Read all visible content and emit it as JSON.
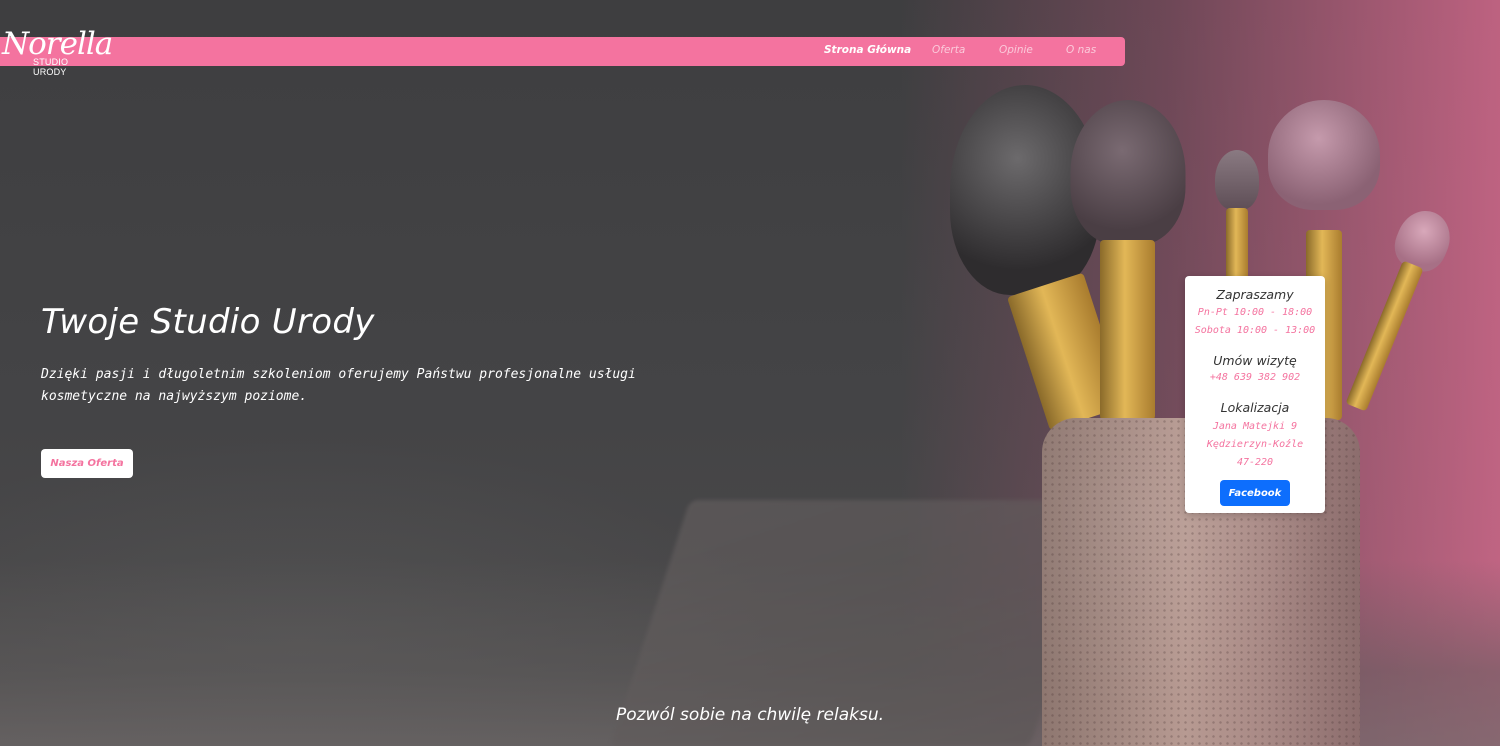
{
  "brand": {
    "logo_script": "Norella",
    "logo_subtitle": "STUDIO URODY"
  },
  "nav": {
    "items": [
      {
        "label": "Strona Główna",
        "active": true
      },
      {
        "label": "Oferta",
        "active": false
      },
      {
        "label": "Opinie",
        "active": false
      },
      {
        "label": "O nas",
        "active": false
      }
    ]
  },
  "hero": {
    "title": "Twoje Studio Urody",
    "description": "Dzięki pasji i długoletnim szkoleniom oferujemy Państwu profesjonalne usługi kosmetyczne na najwyższym poziome.",
    "button_label": "Nasza Oferta",
    "tagline": "Pozwól sobie na chwilę relaksu."
  },
  "info_card": {
    "hours_heading": "Zapraszamy",
    "hours_weekdays": "Pn-Pt 10:00 - 18:00",
    "hours_saturday": "Sobota 10:00 - 13:00",
    "contact_heading": "Umów wizytę",
    "phone": "+48 639 382 902",
    "location_heading": "Lokalizacja",
    "street": "Jana Matejki 9",
    "city": "Kędzierzyn-Koźle",
    "postal_code": "47-220",
    "facebook_label": "Facebook"
  },
  "colors": {
    "accent_pink": "#f4739f",
    "facebook_blue": "#0d6efd",
    "overlay_dark": "#3c3c3e"
  }
}
